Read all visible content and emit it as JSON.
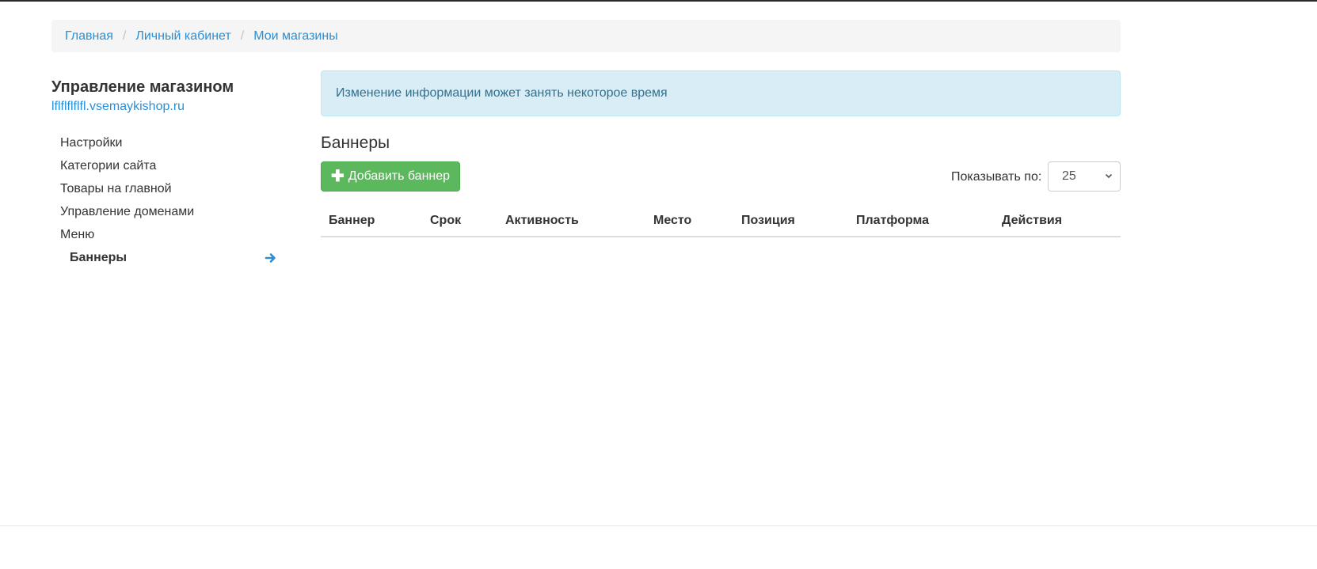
{
  "breadcrumb": [
    {
      "label": "Главная"
    },
    {
      "label": "Личный кабинет"
    },
    {
      "label": "Мои магазины"
    }
  ],
  "sidebar": {
    "title": "Управление магазином",
    "domain": "lflflflflfl.vsemaykishop.ru",
    "items": [
      {
        "label": "Настройки"
      },
      {
        "label": "Категории сайта"
      },
      {
        "label": "Товары на главной"
      },
      {
        "label": "Управление доменами"
      },
      {
        "label": "Меню"
      },
      {
        "label": "Баннеры",
        "active": true
      }
    ]
  },
  "alert": {
    "text": "Изменение информации может занять некоторое время"
  },
  "main": {
    "title": "Баннеры",
    "add_button": "Добавить баннер",
    "per_page_label": "Показывать по:",
    "per_page_value": "25",
    "columns": [
      "Баннер",
      "Срок",
      "Активность",
      "Место",
      "Позиция",
      "Платформа",
      "Действия"
    ]
  },
  "colors": {
    "link": "#2a8fd6",
    "success": "#5cb85c",
    "info_bg": "#d9edf7",
    "info_text": "#31708f"
  },
  "icons": {
    "add": "plus-icon",
    "active_marker": "arrow-right-icon",
    "select_caret": "chevron-down-icon"
  }
}
